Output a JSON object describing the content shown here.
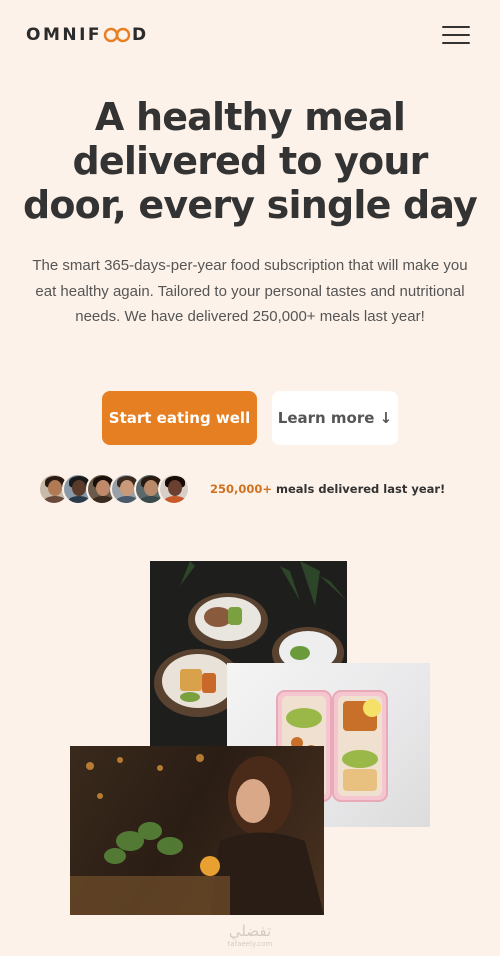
{
  "header": {
    "logo_left": "OMNIF",
    "logo_right": "D",
    "menu_icon": "hamburger-menu-icon"
  },
  "hero": {
    "title_line1": "A healthy meal",
    "title_line2": "delivered to your",
    "title_line3": "door, every single day",
    "description": "The smart 365-days-per-year food subscription that will make you eat healthy again. Tailored to your personal tastes and nutritional needs. We have delivered 250,000+ meals last year!",
    "primary_button": "Start eating well",
    "secondary_button": "Learn more ↓"
  },
  "delivered": {
    "count": "250,000+",
    "text": " meals delivered last year!",
    "customer_count": 6
  },
  "images": {
    "bowls": "food-bowls-image",
    "boxes": "meal-prep-boxes-image",
    "woman": "woman-eating-image"
  },
  "watermark": {
    "main": "تفضلي",
    "sub": "tafaeely.com"
  },
  "colors": {
    "background": "#fdf2e9",
    "primary": "#e67e22",
    "accent_text": "#cf711f",
    "heading": "#333333"
  }
}
